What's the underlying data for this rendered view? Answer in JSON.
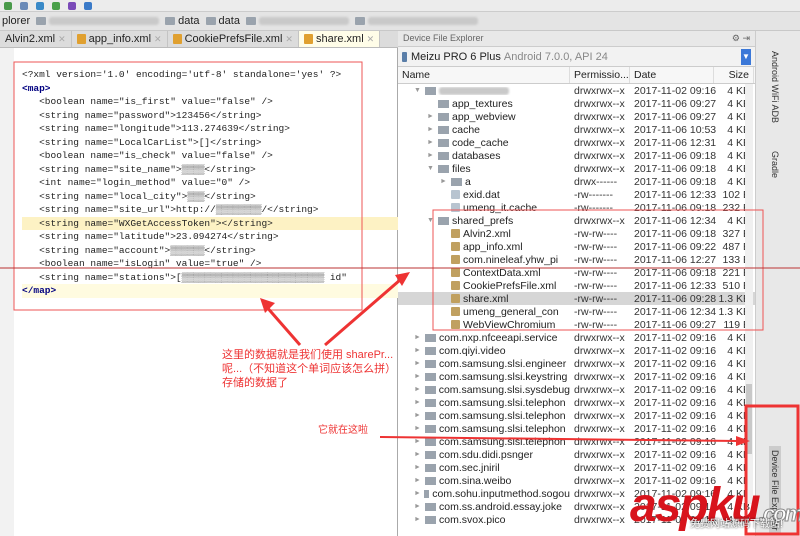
{
  "breadcrumb": {
    "first": "plorer",
    "items": [
      "data",
      "data"
    ]
  },
  "tabs": [
    {
      "label": "Alvin2.xml"
    },
    {
      "label": "app_info.xml"
    },
    {
      "label": "CookiePrefsFile.xml"
    },
    {
      "label": "share.xml",
      "active": true
    }
  ],
  "editor": {
    "lines": [
      "<?xml version='1.0' encoding='utf-8' standalone='yes' ?>",
      "<map>",
      "<boolean name=\"is_first\" value=\"false\" />",
      "<string name=\"password\">123456</string>",
      "<string name=\"longitude\">113.274639</string>",
      "<string name=\"LocalCarList\">[]</string>",
      "<boolean name=\"is_check\" value=\"false\" />",
      "<string name=\"site_name\">▒▒▒▒</string>",
      "<int name=\"login_method\" value=\"0\" />",
      "<string name=\"local_city\">▒▒▒</string>",
      "<string name=\"site_url\">http://▒▒▒▒▒▒▒▒/</string>",
      "<string name=\"WXGetAccessToken\"></string>",
      "<string name=\"latitude\">23.094274</string>",
      "<string name=\"account\">▒▒▒▒▒▒</string>",
      "<boolean name=\"isLogin\" value=\"true\" />",
      "<string name=\"stations\">[▒▒▒▒▒▒▒▒▒▒▒▒▒▒▒▒▒▒▒▒▒▒▒▒▒ id\"",
      "</map>"
    ]
  },
  "explorer": {
    "title": "Device File Explorer",
    "device": "Meizu PRO 6 Plus",
    "device_sub": "Android 7.0.0, API 24",
    "columns": [
      "Name",
      "Permissio...",
      "Date",
      "Size"
    ],
    "rows": [
      {
        "name": "",
        "indent": 2,
        "exp": "▼",
        "type": "dir",
        "perm": "drwxrwx--x",
        "date": "2017-11-02 09:16",
        "size": "4 KB"
      },
      {
        "name": "app_textures",
        "indent": 3,
        "exp": "",
        "type": "dir",
        "perm": "drwxrwx--x",
        "date": "2017-11-06 09:27",
        "size": "4 KB"
      },
      {
        "name": "app_webview",
        "indent": 3,
        "exp": "►",
        "type": "dir",
        "perm": "drwxrwx--x",
        "date": "2017-11-06 09:27",
        "size": "4 KB"
      },
      {
        "name": "cache",
        "indent": 3,
        "exp": "►",
        "type": "dir",
        "perm": "drwxrwx--x",
        "date": "2017-11-06 10:53",
        "size": "4 KB"
      },
      {
        "name": "code_cache",
        "indent": 3,
        "exp": "►",
        "type": "dir",
        "perm": "drwxrwx--x",
        "date": "2017-11-06 12:31",
        "size": "4 KB"
      },
      {
        "name": "databases",
        "indent": 3,
        "exp": "►",
        "type": "dir",
        "perm": "drwxrwx--x",
        "date": "2017-11-06 09:18",
        "size": "4 KB"
      },
      {
        "name": "files",
        "indent": 3,
        "exp": "▼",
        "type": "dir",
        "perm": "drwxrwx--x",
        "date": "2017-11-06 09:18",
        "size": "4 KB"
      },
      {
        "name": "a",
        "indent": 4,
        "exp": "►",
        "type": "dir",
        "perm": "drwx------",
        "date": "2017-11-06 09:18",
        "size": "4 KB"
      },
      {
        "name": "exid.dat",
        "indent": 4,
        "exp": "",
        "type": "file",
        "perm": "-rw-------",
        "date": "2017-11-06 12:33",
        "size": "102 B"
      },
      {
        "name": "umeng_it.cache",
        "indent": 4,
        "exp": "",
        "type": "file",
        "perm": "-rw-------",
        "date": "2017-11-06 09:18",
        "size": "232 B"
      },
      {
        "name": "shared_prefs",
        "indent": 3,
        "exp": "▼",
        "type": "dir",
        "perm": "drwxrwx--x",
        "date": "2017-11-06 12:34",
        "size": "4 KB"
      },
      {
        "name": "Alvin2.xml",
        "indent": 4,
        "exp": "",
        "type": "xml",
        "perm": "-rw-rw----",
        "date": "2017-11-06 09:18",
        "size": "327 B"
      },
      {
        "name": "app_info.xml",
        "indent": 4,
        "exp": "",
        "type": "xml",
        "perm": "-rw-rw----",
        "date": "2017-11-06 09:22",
        "size": "487 B"
      },
      {
        "name": "com.nineleaf.yhw_pi",
        "indent": 4,
        "exp": "",
        "type": "xml",
        "perm": "-rw-rw----",
        "date": "2017-11-06 12:27",
        "size": "133 B"
      },
      {
        "name": "ContextData.xml",
        "indent": 4,
        "exp": "",
        "type": "xml",
        "perm": "-rw-rw----",
        "date": "2017-11-06 09:18",
        "size": "221 B"
      },
      {
        "name": "CookiePrefsFile.xml",
        "indent": 4,
        "exp": "",
        "type": "xml",
        "perm": "-rw-rw----",
        "date": "2017-11-06 12:33",
        "size": "510 B"
      },
      {
        "name": "share.xml",
        "indent": 4,
        "exp": "",
        "type": "xml",
        "perm": "-rw-rw----",
        "date": "2017-11-06 09:28",
        "size": "1.3 KB",
        "selected": true
      },
      {
        "name": "umeng_general_con",
        "indent": 4,
        "exp": "",
        "type": "xml",
        "perm": "-rw-rw----",
        "date": "2017-11-06 12:34",
        "size": "1.3 KB"
      },
      {
        "name": "WebViewChromium",
        "indent": 4,
        "exp": "",
        "type": "xml",
        "perm": "-rw-rw----",
        "date": "2017-11-06 09:27",
        "size": "119 B"
      },
      {
        "name": "com.nxp.nfceeapi.service",
        "indent": 2,
        "exp": "►",
        "type": "dir",
        "perm": "drwxrwx--x",
        "date": "2017-11-02 09:16",
        "size": "4 KB"
      },
      {
        "name": "com.qiyi.video",
        "indent": 2,
        "exp": "►",
        "type": "dir",
        "perm": "drwxrwx--x",
        "date": "2017-11-02 09:16",
        "size": "4 KB"
      },
      {
        "name": "com.samsung.slsi.engineer",
        "indent": 2,
        "exp": "►",
        "type": "dir",
        "perm": "drwxrwx--x",
        "date": "2017-11-02 09:16",
        "size": "4 KB"
      },
      {
        "name": "com.samsung.slsi.keystring",
        "indent": 2,
        "exp": "►",
        "type": "dir",
        "perm": "drwxrwx--x",
        "date": "2017-11-02 09:16",
        "size": "4 KB"
      },
      {
        "name": "com.samsung.slsi.sysdebug",
        "indent": 2,
        "exp": "►",
        "type": "dir",
        "perm": "drwxrwx--x",
        "date": "2017-11-02 09:16",
        "size": "4 KB"
      },
      {
        "name": "com.samsung.slsi.telephon",
        "indent": 2,
        "exp": "►",
        "type": "dir",
        "perm": "drwxrwx--x",
        "date": "2017-11-02 09:16",
        "size": "4 KB"
      },
      {
        "name": "com.samsung.slsi.telephon",
        "indent": 2,
        "exp": "►",
        "type": "dir",
        "perm": "drwxrwx--x",
        "date": "2017-11-02 09:16",
        "size": "4 KB"
      },
      {
        "name": "com.samsung.slsi.telephon",
        "indent": 2,
        "exp": "►",
        "type": "dir",
        "perm": "drwxrwx--x",
        "date": "2017-11-02 09:16",
        "size": "4 KB"
      },
      {
        "name": "com.samsung.slsi.telephon",
        "indent": 2,
        "exp": "►",
        "type": "dir",
        "perm": "drwxrwx--x",
        "date": "2017-11-02 09:16",
        "size": "4 KB"
      },
      {
        "name": "com.sdu.didi.psnger",
        "indent": 2,
        "exp": "►",
        "type": "dir",
        "perm": "drwxrwx--x",
        "date": "2017-11-02 09:16",
        "size": "4 KB"
      },
      {
        "name": "com.sec.jniril",
        "indent": 2,
        "exp": "►",
        "type": "dir",
        "perm": "drwxrwx--x",
        "date": "2017-11-02 09:16",
        "size": "4 KB"
      },
      {
        "name": "com.sina.weibo",
        "indent": 2,
        "exp": "►",
        "type": "dir",
        "perm": "drwxrwx--x",
        "date": "2017-11-02 09:16",
        "size": "4 KB"
      },
      {
        "name": "com.sohu.inputmethod.sogou",
        "indent": 2,
        "exp": "►",
        "type": "dir",
        "perm": "drwxrwx--x",
        "date": "2017-11-02 09:16",
        "size": "4 KB"
      },
      {
        "name": "com.ss.android.essay.joke",
        "indent": 2,
        "exp": "►",
        "type": "dir",
        "perm": "drwxrwx--x",
        "date": "2017-11-02 09:16",
        "size": "4 KB"
      },
      {
        "name": "com.svox.pico",
        "indent": 2,
        "exp": "►",
        "type": "dir",
        "perm": "drwxrwx--x",
        "date": "2017-11-02 09:16",
        "size": "4 KB"
      }
    ]
  },
  "side": {
    "adb": "Android WiFi ADB",
    "gradle": "Gradle",
    "dfe": "Device File Explorer"
  },
  "annotations": {
    "main": [
      "这里的数据就是我们使用 sharePr...",
      "呢...（不知道这个单词应该怎么拼）",
      "存储的数据了"
    ],
    "here": "它就在这啦"
  },
  "watermark": {
    "logo": "aspku.com",
    "sub": "免费网站源码下载站!"
  }
}
